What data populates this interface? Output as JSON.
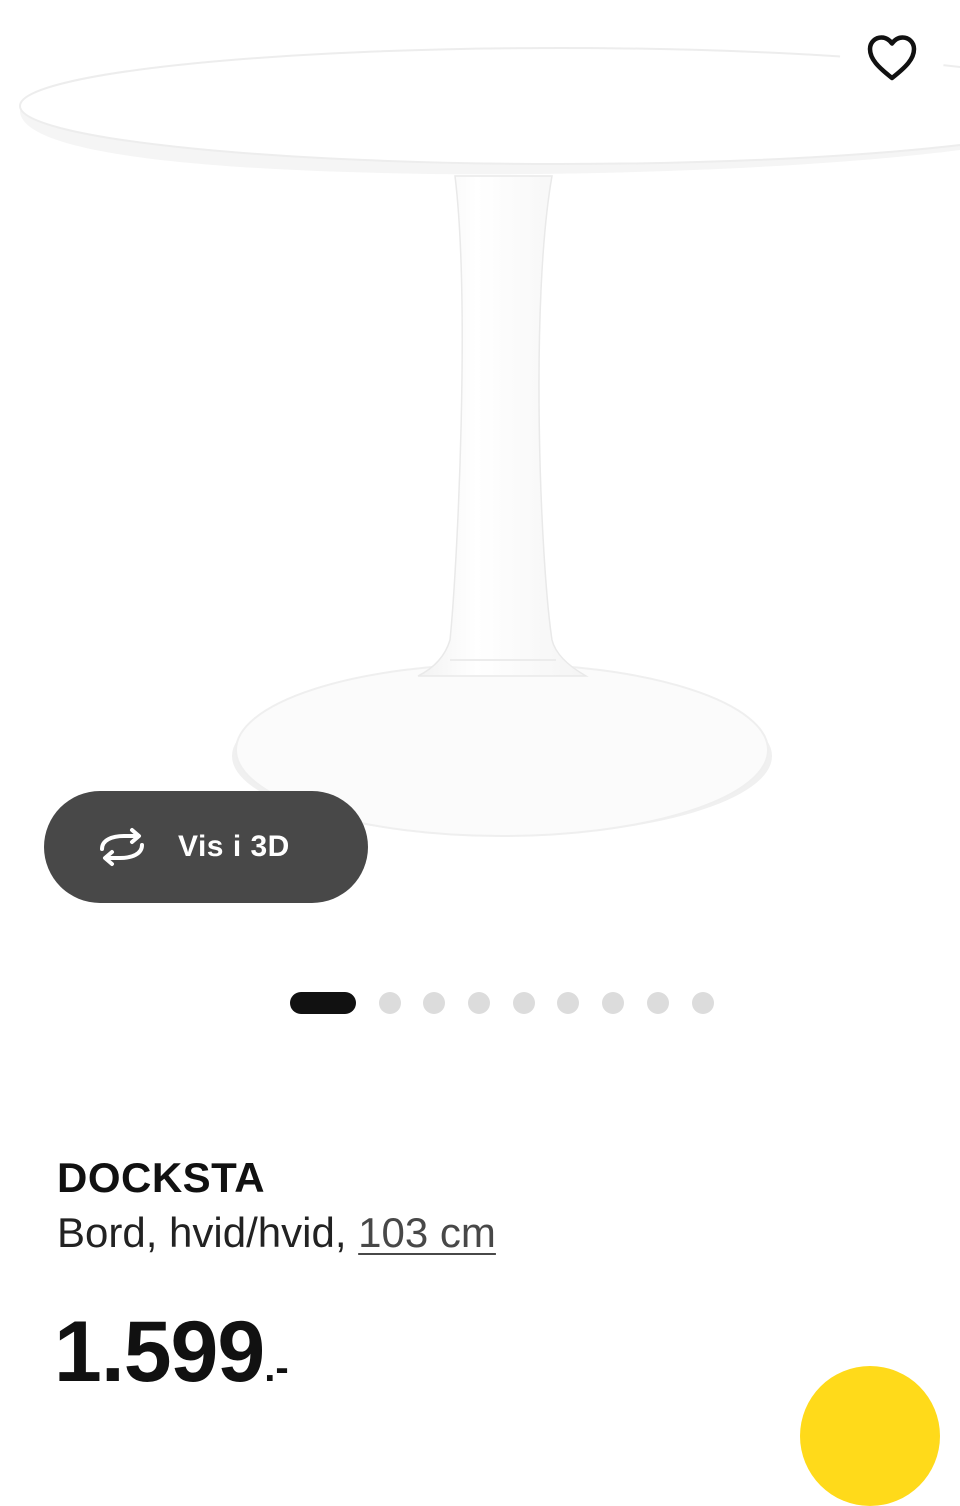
{
  "product": {
    "name": "DOCKSTA",
    "description_prefix": "Bord, hvid/hvid, ",
    "size_link": "103 cm",
    "price_main": "1.599",
    "price_suffix": ".-"
  },
  "gallery": {
    "view_3d_label": "Vis i 3D",
    "dot_count": 9,
    "active_index": 0,
    "image_subject": "white round pedestal table"
  },
  "icons": {
    "favorite": "heart-outline-icon",
    "view_3d": "rotate-3d-icon"
  },
  "colors": {
    "accent_yellow": "#ffda1a",
    "button_dark": "#484848",
    "text": "#111111",
    "dot_inactive": "#dcdcdc",
    "dot_active": "#111111"
  }
}
